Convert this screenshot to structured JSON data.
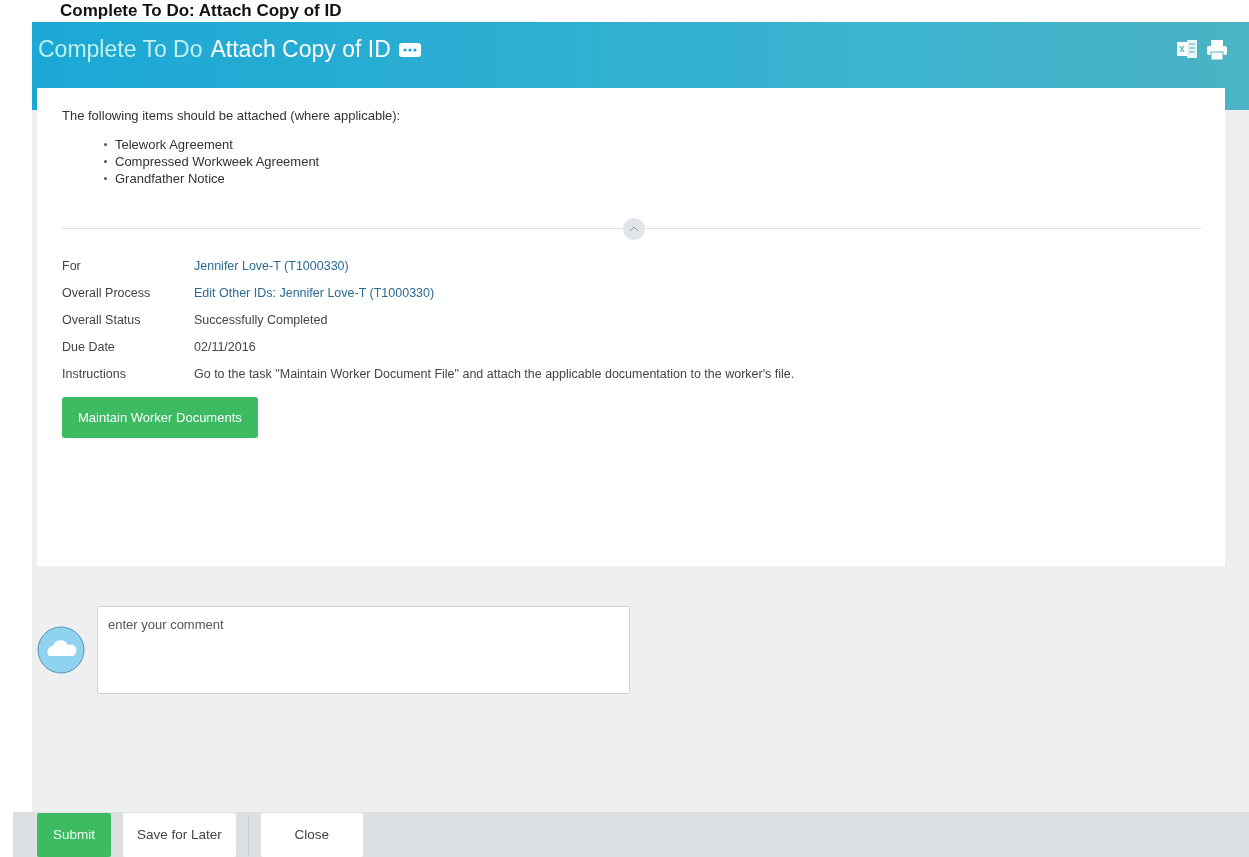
{
  "page_heading": "Complete To Do: Attach Copy of ID",
  "header": {
    "prefix": "Complete To Do",
    "title": "Attach Copy of ID"
  },
  "intro": "The following items should be attached (where applicable):",
  "items": [
    "Telework Agreement",
    "Compressed Workweek Agreement",
    "Grandfather Notice"
  ],
  "fields": [
    {
      "label": "For",
      "value": "Jennifer Love-T (T1000330)",
      "kind": "link"
    },
    {
      "label": "Overall Process",
      "value": "Edit Other IDs: Jennifer Love-T (T1000330)",
      "kind": "link"
    },
    {
      "label": "Overall Status",
      "value": "Successfully Completed",
      "kind": "text"
    },
    {
      "label": "Due Date",
      "value": "02/11/2016",
      "kind": "text"
    },
    {
      "label": "Instructions",
      "value": "Go to the task \"Maintain Worker Document File\" and attach the applicable documentation to the worker's file.",
      "kind": "text"
    }
  ],
  "action_button": "Maintain Worker Documents",
  "comment": {
    "placeholder": "enter your comment"
  },
  "footer_buttons": [
    {
      "label": "Submit",
      "kind": "primary"
    },
    {
      "label": "Save for Later",
      "kind": "secondary"
    },
    {
      "label": "Close",
      "kind": "secondary"
    }
  ]
}
